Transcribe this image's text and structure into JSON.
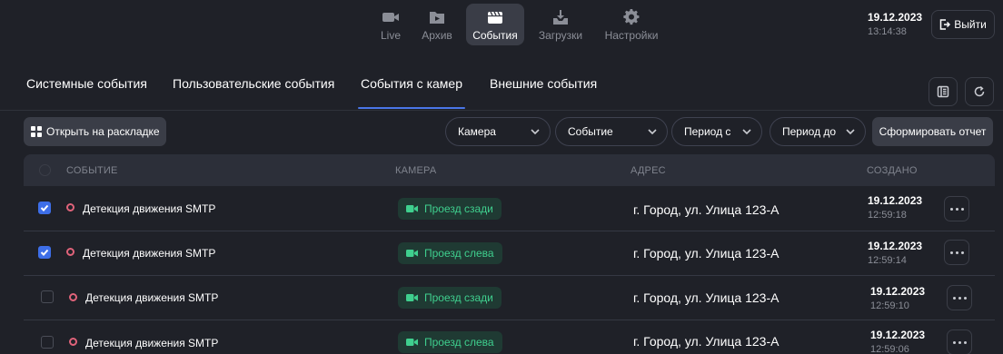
{
  "nav": {
    "items": [
      {
        "label": "Live",
        "icon": "video-camera-icon"
      },
      {
        "label": "Архив",
        "icon": "archive-folder-icon"
      },
      {
        "label": "События",
        "icon": "clapperboard-icon"
      },
      {
        "label": "Загрузки",
        "icon": "download-tray-icon"
      },
      {
        "label": "Настройки",
        "icon": "gear-icon"
      }
    ],
    "active": "События"
  },
  "header": {
    "date": "19.12.2023",
    "time": "13:14:38",
    "logout_label": "Выйти"
  },
  "tabs": {
    "items": [
      "Системные события",
      "Пользовательские события",
      "События с камер",
      "Внешние события"
    ],
    "active": "События с камер"
  },
  "toolbar": {
    "open_layout_label": "Открыть на раскладке",
    "filters": [
      "Камера",
      "Событие",
      "Период с",
      "Период до"
    ],
    "report_label": "Сформировать отчет"
  },
  "table": {
    "columns": [
      "СОБЫТИЕ",
      "КАМЕРА",
      "АДРЕС",
      "СОЗДАНО"
    ],
    "rows": [
      {
        "checked": true,
        "event": "Детекция движения SMTP",
        "camera": "Проезд сзади",
        "address": "г. Город, ул. Улица 123-А",
        "date": "19.12.2023",
        "time": "12:59:18"
      },
      {
        "checked": true,
        "event": "Детекция движения SMTP",
        "camera": "Проезд слева",
        "address": "г. Город, ул. Улица 123-А",
        "date": "19.12.2023",
        "time": "12:59:14"
      },
      {
        "checked": false,
        "event": "Детекция движения SMTP",
        "camera": "Проезд сзади",
        "address": "г. Город, ул. Улица 123-А",
        "date": "19.12.2023",
        "time": "12:59:10"
      },
      {
        "checked": false,
        "event": "Детекция движения SMTP",
        "camera": "Проезд слева",
        "address": "г. Город, ул. Улица 123-А",
        "date": "19.12.2023",
        "time": "12:59:06"
      }
    ]
  },
  "colors": {
    "background": "#1f2128",
    "accent": "#4a76e8",
    "checkbox": "#3d6ee8",
    "camera_badge_text": "#3fcf8e",
    "status_dot": "#e0637a"
  }
}
